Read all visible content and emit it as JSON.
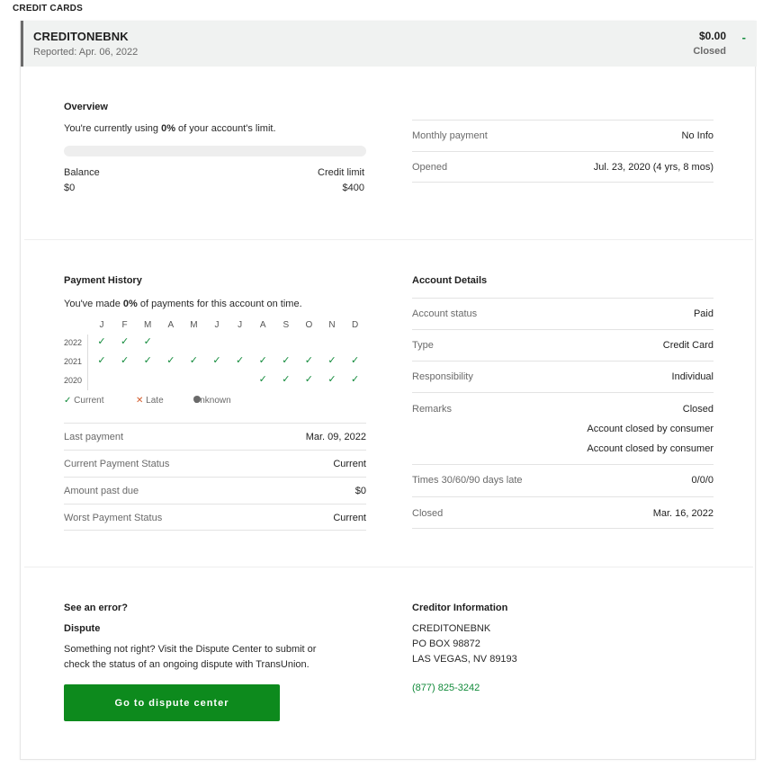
{
  "section": "CREDIT CARDS",
  "account": {
    "name": "CREDITONEBNK",
    "reported": "Reported: Apr. 06, 2022",
    "amount": "$0.00",
    "status": "Closed",
    "collapse_glyph": "-"
  },
  "overview": {
    "title": "Overview",
    "usage_prefix": "You're currently using ",
    "usage_value": "0%",
    "usage_suffix": " of your account's limit.",
    "usage_fraction": 0,
    "balance_label": "Balance",
    "balance_value": "$0",
    "limit_label": "Credit limit",
    "limit_value": "$400",
    "rows": [
      {
        "label": "Monthly payment",
        "value": "No Info"
      },
      {
        "label": "Opened",
        "value": "Jul. 23, 2020 (4 yrs, 8 mos)"
      }
    ]
  },
  "payment_history": {
    "title": "Payment History",
    "ontime_prefix": "You've made ",
    "ontime_value": "0%",
    "ontime_suffix": " of payments for this account on time.",
    "months": [
      "J",
      "F",
      "M",
      "A",
      "M",
      "J",
      "J",
      "A",
      "S",
      "O",
      "N",
      "D"
    ],
    "years": [
      {
        "year": "2022",
        "status": [
          "current",
          "current",
          "current",
          "",
          "",
          "",
          "",
          "",
          "",
          "",
          "",
          ""
        ]
      },
      {
        "year": "2021",
        "status": [
          "current",
          "current",
          "current",
          "current",
          "current",
          "current",
          "current",
          "current",
          "current",
          "current",
          "current",
          "current"
        ]
      },
      {
        "year": "2020",
        "status": [
          "",
          "",
          "",
          "",
          "",
          "",
          "",
          "current",
          "current",
          "current",
          "current",
          "current"
        ]
      }
    ],
    "legend": {
      "current": "Current",
      "late": "Late",
      "unknown": "Unknown"
    },
    "rows": [
      {
        "label": "Last payment",
        "value": "Mar. 09, 2022"
      },
      {
        "label": "Current Payment Status",
        "value": "Current"
      },
      {
        "label": "Amount past due",
        "value": "$0"
      },
      {
        "label": "Worst Payment Status",
        "value": "Current"
      }
    ]
  },
  "account_details": {
    "title": "Account Details",
    "rows": [
      {
        "label": "Account status",
        "value": "Paid"
      },
      {
        "label": "Type",
        "value": "Credit Card"
      },
      {
        "label": "Responsibility",
        "value": "Individual"
      },
      {
        "label": "Remarks",
        "value": "Closed",
        "extra": [
          "Account closed by consumer",
          "Account closed by consumer"
        ]
      },
      {
        "label": "Times 30/60/90 days late",
        "value": "0/0/0"
      },
      {
        "label": "Closed",
        "value": "Mar. 16, 2022"
      }
    ]
  },
  "dispute": {
    "title": "See an error?",
    "subtitle": "Dispute",
    "text_line1": "Something not right? Visit the Dispute Center to submit or",
    "text_line2": "check the status of an ongoing dispute with TransUnion.",
    "button": "Go to dispute center"
  },
  "creditor": {
    "title": "Creditor Information",
    "name": "CREDITONEBNK",
    "address1": "PO BOX 98872",
    "address2": "LAS VEGAS, NV 89193",
    "phone": "(877) 825-3242"
  },
  "colors": {
    "accent": "#118a3a",
    "button": "#0d8a1d",
    "late": "#d25a2a"
  }
}
